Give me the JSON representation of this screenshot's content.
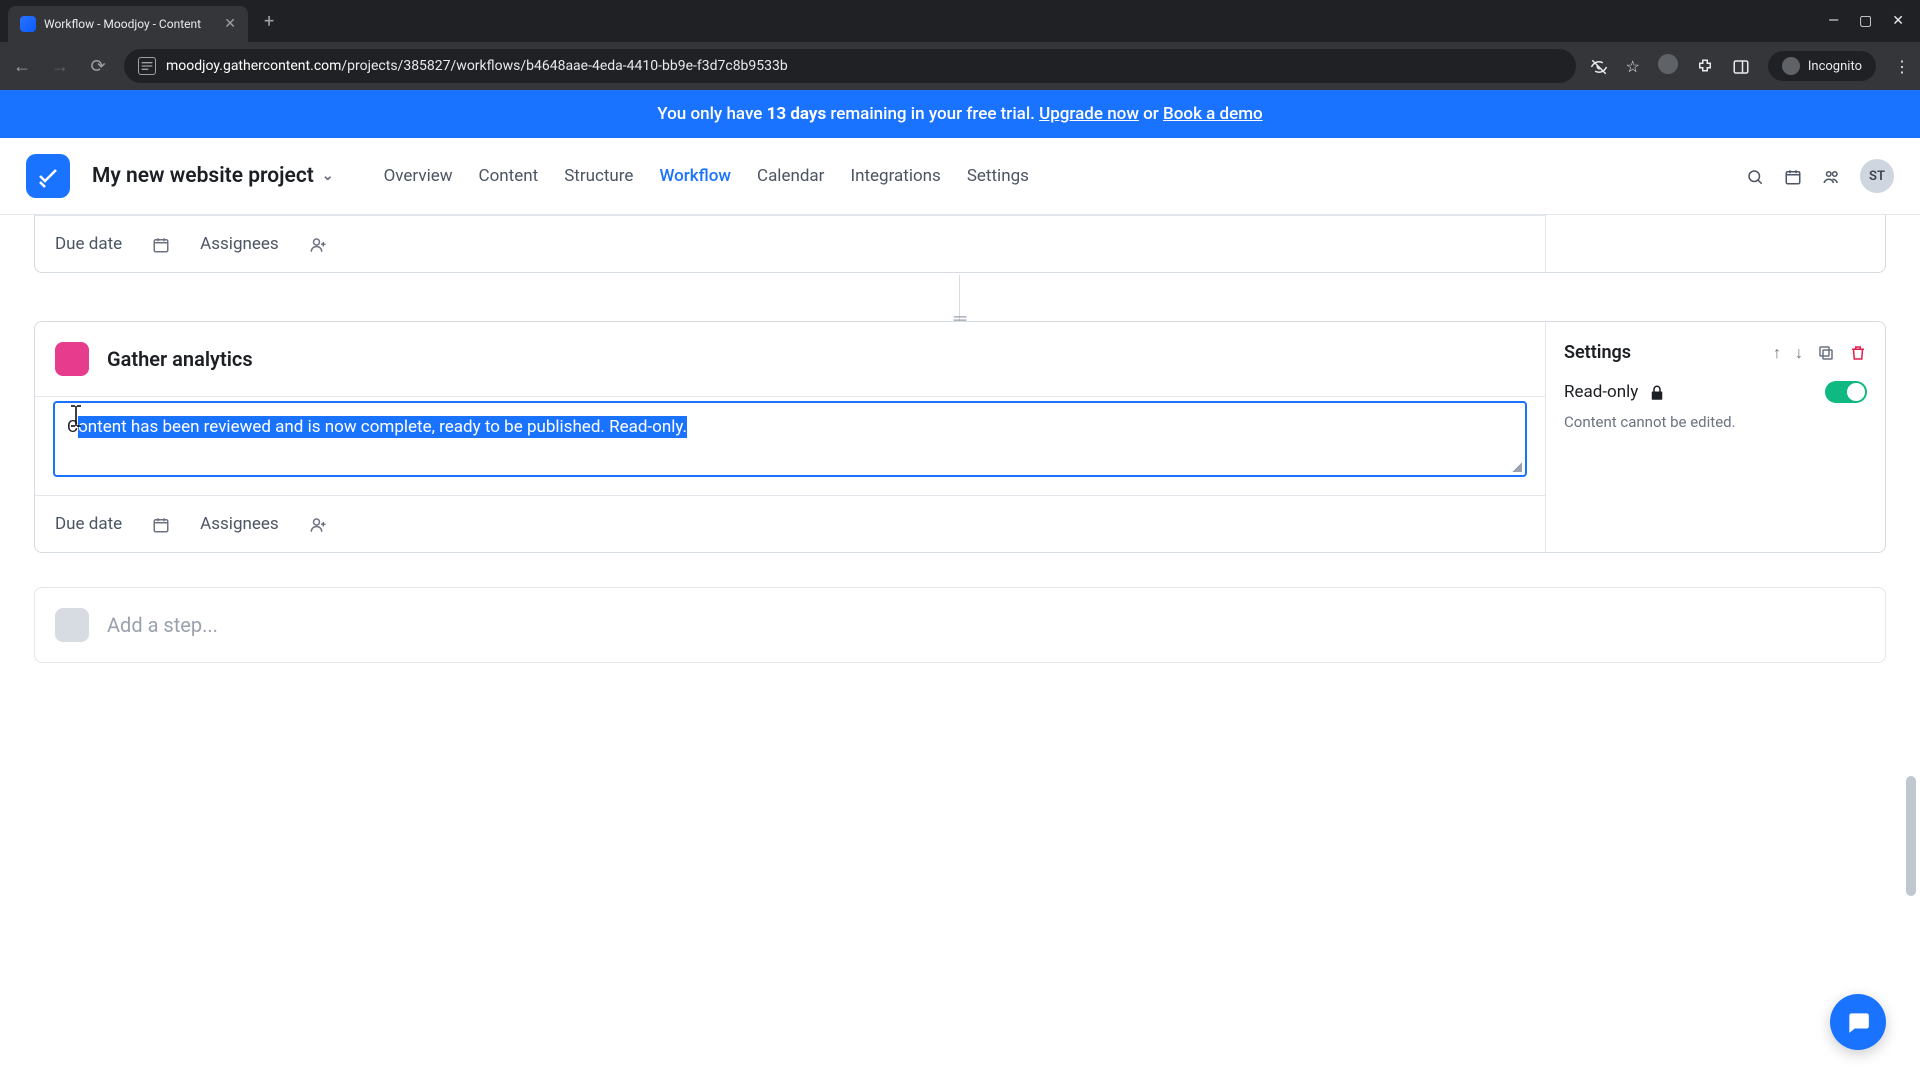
{
  "browser": {
    "tab_title": "Workflow - Moodjoy - Content",
    "url_host": "moodjoy.gathercontent.com",
    "url_path": "/projects/385827/workflows/b4648aae-4eda-4410-bb9e-f3d7c8b9533b",
    "incognito": "Incognito"
  },
  "banner": {
    "prefix": "You only have ",
    "days": "13 days",
    "mid": " remaining in your free trial. ",
    "upgrade": "Upgrade now",
    "or": " or ",
    "demo": "Book a demo"
  },
  "topbar": {
    "project": "My new website project",
    "avatar": "ST",
    "nav": [
      "Overview",
      "Content",
      "Structure",
      "Workflow",
      "Calendar",
      "Integrations",
      "Settings"
    ],
    "active_index": 3
  },
  "step_prev": {
    "due_date": "Due date",
    "assignees": "Assignees"
  },
  "step": {
    "title": "Gather analytics",
    "description": "Content has been reviewed and is now complete, ready to be published. Read-only.",
    "due_date": "Due date",
    "assignees": "Assignees"
  },
  "settings": {
    "heading": "Settings",
    "readonly_label": "Read-only",
    "readonly_hint": "Content cannot be edited."
  },
  "add_step": "Add a step...",
  "colors": {
    "accent": "#1a73ff",
    "pink": "#e73b8e",
    "success": "#10b981",
    "danger": "#e11d48"
  }
}
